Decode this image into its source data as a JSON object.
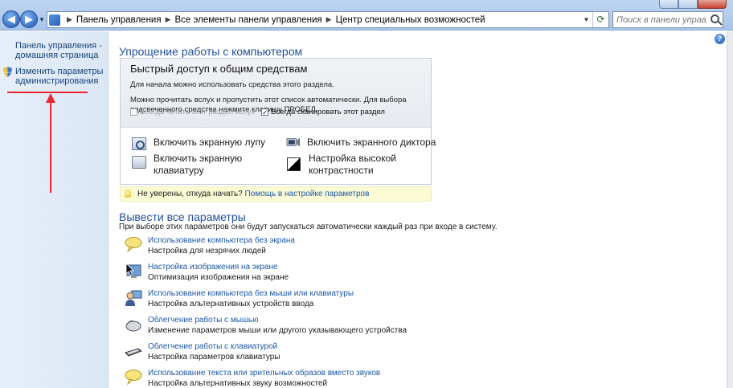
{
  "address": {
    "crumbs": [
      "Панель управления",
      "Все элементы панели управления",
      "Центр специальных возможностей"
    ]
  },
  "search": {
    "placeholder": "Поиск в панели управления"
  },
  "sidebar": {
    "home_link": "Панель управления - домашняя страница",
    "admin_link": "Изменить параметры администрирования"
  },
  "help": {
    "label": "?"
  },
  "ease": {
    "heading": "Упрощение работы с компьютером",
    "box_title": "Быстрый доступ к общим средствам",
    "text1": "Для начала можно использовать средства этого раздела.",
    "text2": "Можно прочитать вслух и пропустить этот список автоматически. Для выбора подсвеченного средства нажмите клавишу ПРОБЕЛ.",
    "check_read": "Всегда читать этот раздел вслух",
    "check_scan": "Всегда сканировать этот раздел",
    "check_read_checked": false,
    "check_scan_checked": true,
    "magnifier": "Включить экранную лупу",
    "narrator": "Включить экранного диктора",
    "keyboard": "Включить экранную клавиатуру",
    "contrast": "Настройка высокой контрастности"
  },
  "tip": {
    "question": "Не уверены, откуда начать?",
    "link": "Помощь в настройке параметров"
  },
  "explore": {
    "heading": "Вывести все параметры",
    "subtitle": "При выборе этих параметров они будут запускаться автоматически каждый раз при входе в систему.",
    "items": [
      {
        "link": "Использование компьютера без экрана",
        "desc": "Настройка для незрячих людей",
        "icon": "speech-bubble-icon"
      },
      {
        "link": "Настройка изображения на экране",
        "desc": "Оптимизация изображения на экране",
        "icon": "display-icon"
      },
      {
        "link": "Использование компьютера без мыши или клавиатуры",
        "desc": "Настройка альтернативных устройств ввода",
        "icon": "user-monitor-icon"
      },
      {
        "link": "Облегчение работы с мышью",
        "desc": "Изменение параметров мыши или другого указывающего устройства",
        "icon": "mouse-icon"
      },
      {
        "link": "Облегчение работы с клавиатурой",
        "desc": "Настройка параметров клавиатуры",
        "icon": "keyboard-icon"
      },
      {
        "link": "Использование текста или зрительных образов вместо звуков",
        "desc": "Настройка альтернативных звуку возможностей",
        "icon": "speech-bubbles-icon"
      }
    ]
  }
}
